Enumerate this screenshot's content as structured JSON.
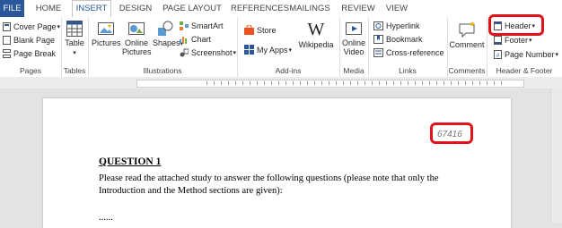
{
  "tabs": [
    {
      "label": "FILE"
    },
    {
      "label": "HOME"
    },
    {
      "label": "INSERT"
    },
    {
      "label": "DESIGN"
    },
    {
      "label": "PAGE LAYOUT"
    },
    {
      "label": "REFERENCES"
    },
    {
      "label": "MAILINGS"
    },
    {
      "label": "REVIEW"
    },
    {
      "label": "VIEW"
    }
  ],
  "ribbon": {
    "pages": {
      "label": "Pages",
      "cover_page": "Cover Page",
      "blank_page": "Blank Page",
      "page_break": "Page Break"
    },
    "tables": {
      "label": "Tables",
      "table": "Table"
    },
    "illustrations": {
      "label": "Illustrations",
      "pictures": "Pictures",
      "online_pictures": "Online Pictures",
      "shapes": "Shapes",
      "smartart": "SmartArt",
      "chart": "Chart",
      "screenshot": "Screenshot"
    },
    "addins": {
      "label": "Add-ins",
      "store": "Store",
      "my_apps": "My Apps",
      "wikipedia": "Wikipedia"
    },
    "media": {
      "label": "Media",
      "online_video": "Online Video"
    },
    "links": {
      "label": "Links",
      "hyperlink": "Hyperlink",
      "bookmark": "Bookmark",
      "cross_reference": "Cross-reference"
    },
    "comments": {
      "label": "Comments",
      "comment": "Comment"
    },
    "header_footer": {
      "label": "Header & Footer",
      "header": "Header",
      "footer": "Footer",
      "page_number": "Page Number"
    }
  },
  "document": {
    "header_number": "67416",
    "heading": "QUESTION 1",
    "paragraph_line1": "Please read the attached study to answer the following questions (please note that only the",
    "paragraph_line2": "Introduction and the Method sections are given):",
    "trailing": "......"
  },
  "colors": {
    "accent": "#2b579a",
    "highlight": "#e0121a"
  }
}
